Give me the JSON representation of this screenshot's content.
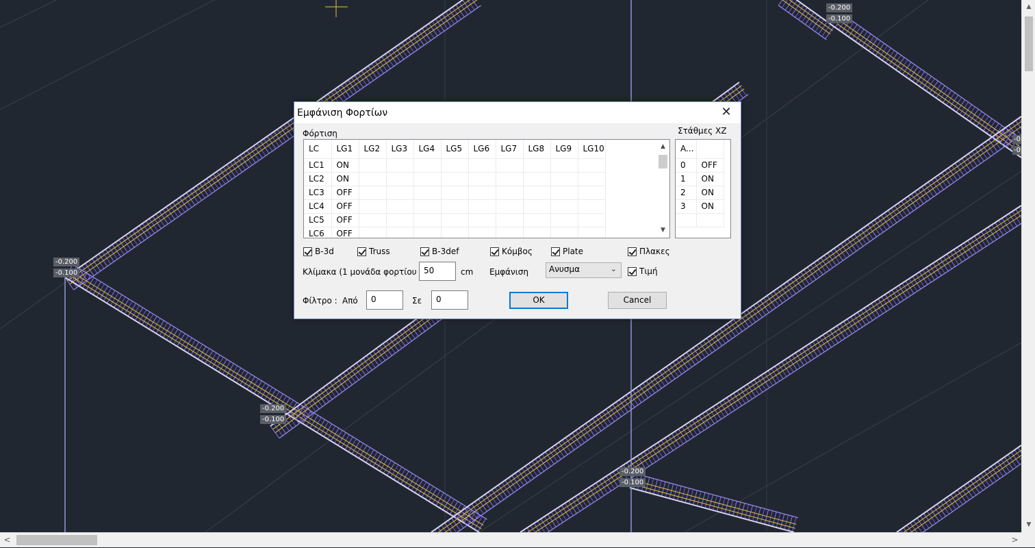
{
  "dialog": {
    "title": "Εμφάνιση Φορτίων",
    "close_glyph": "✕",
    "loadcase_group_label": "Φόρτιση",
    "loadcase_table": {
      "headers": [
        "LC",
        "LG1",
        "LG2",
        "LG3",
        "LG4",
        "LG5",
        "LG6",
        "LG7",
        "LG8",
        "LG9",
        "LG10"
      ],
      "rows": [
        [
          "LC1",
          "ON",
          "",
          "",
          "",
          "",
          "",
          "",
          "",
          "",
          ""
        ],
        [
          "LC2",
          "ON",
          "",
          "",
          "",
          "",
          "",
          "",
          "",
          "",
          ""
        ],
        [
          "LC3",
          "OFF",
          "",
          "",
          "",
          "",
          "",
          "",
          "",
          "",
          ""
        ],
        [
          "LC4",
          "OFF",
          "",
          "",
          "",
          "",
          "",
          "",
          "",
          "",
          ""
        ],
        [
          "LC5",
          "OFF",
          "",
          "",
          "",
          "",
          "",
          "",
          "",
          "",
          ""
        ],
        [
          "LC6",
          "OFF",
          "",
          "",
          "",
          "",
          "",
          "",
          "",
          "",
          ""
        ]
      ]
    },
    "levels_label": "Στάθμες XZ",
    "levels_table": {
      "headers": [
        "A...",
        ""
      ],
      "rows": [
        [
          "0",
          "OFF"
        ],
        [
          "1",
          "ON"
        ],
        [
          "2",
          "ON"
        ],
        [
          "3",
          "ON"
        ],
        [
          "",
          ""
        ]
      ]
    },
    "checkboxes": [
      {
        "label": "B-3d",
        "checked": true
      },
      {
        "label": "Truss",
        "checked": true
      },
      {
        "label": "B-3def",
        "checked": true
      },
      {
        "label": "Κόμβος",
        "checked": true
      },
      {
        "label": "Plate",
        "checked": true
      },
      {
        "label": "Πλακες",
        "checked": true
      }
    ],
    "scale_label": "Κλίμακα  (1 μονάδα φορτίου",
    "scale_value": "50",
    "scale_unit": "cm",
    "display_label": "Εμφάνιση",
    "display_value": "Ανυσμα",
    "value_checkbox": {
      "label": "Τιμή",
      "checked": true
    },
    "filter_label": "Φίλτρο :",
    "from_label": "Από",
    "from_value": "0",
    "to_label": "Σε",
    "to_value": "0",
    "ok_label": "OK",
    "cancel_label": "Cancel"
  },
  "drawing": {
    "node_tags": [
      {
        "top": "-0.200",
        "bottom": "-0.100"
      },
      {
        "top": "-0.200",
        "bottom": "-0.100"
      },
      {
        "top": "-0.200",
        "bottom": "-0.100"
      },
      {
        "top": "-0.200",
        "bottom": "-0.100"
      },
      {
        "top": "-0",
        "bottom": "-0"
      }
    ]
  }
}
